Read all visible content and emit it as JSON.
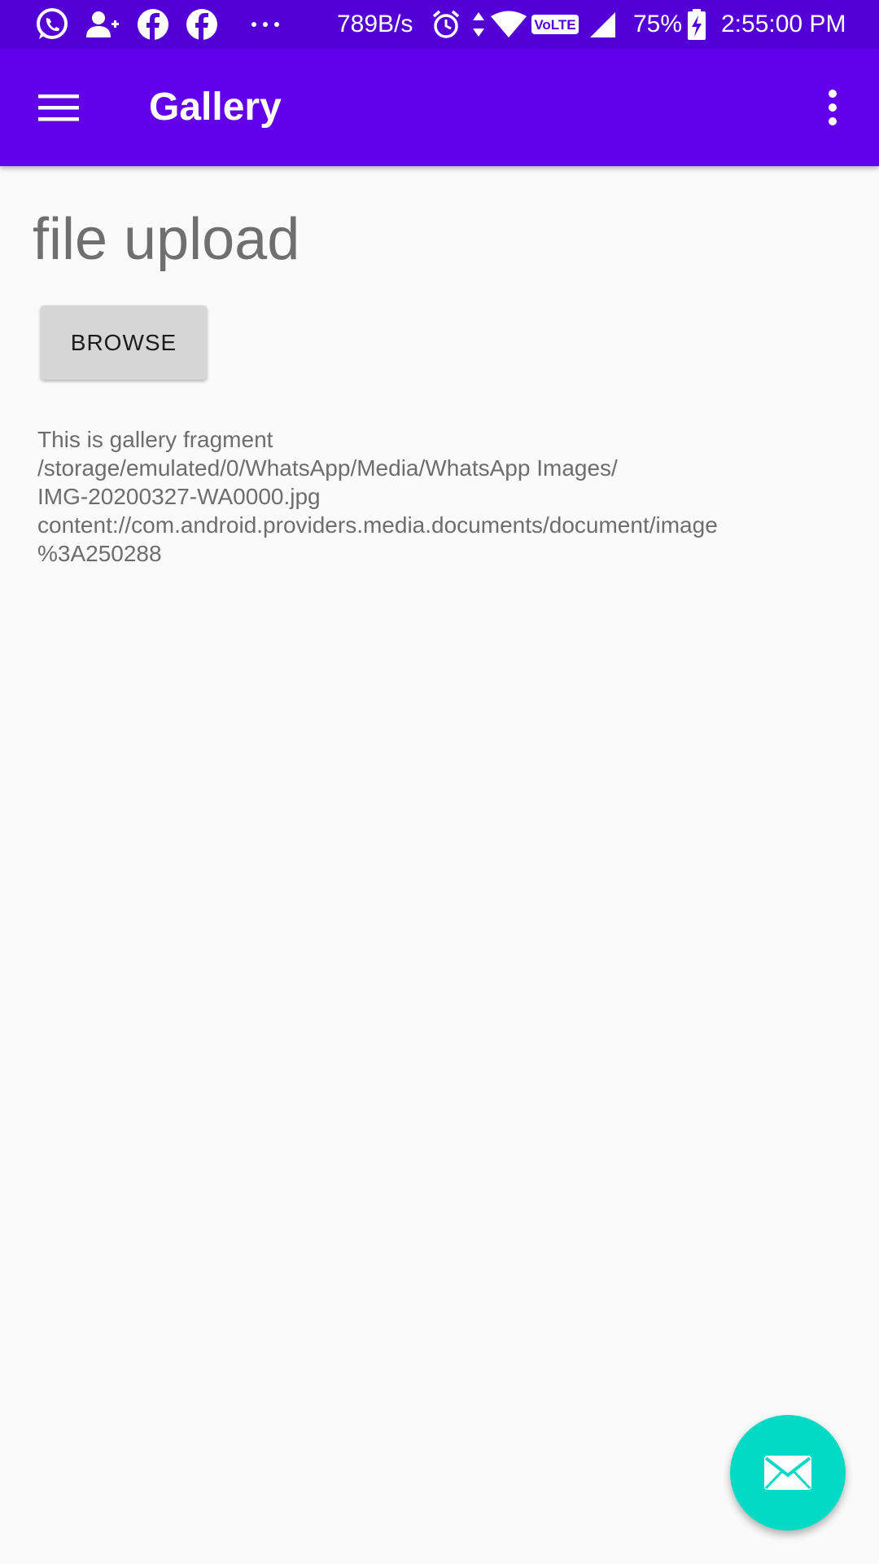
{
  "status_bar": {
    "net_speed": "789B/s",
    "battery": "75%",
    "time": "2:55:00 PM",
    "volte": "VoLTE",
    "notification_icons": [
      "whatsapp-icon",
      "person-add-icon",
      "facebook-icon",
      "facebook-icon",
      "more-dots-icon"
    ],
    "system_icons": [
      "alarm-icon",
      "data-arrows-icon",
      "wifi-icon",
      "volte-icon",
      "signal-icon",
      "battery-charging-icon"
    ]
  },
  "app_bar": {
    "title": "Gallery",
    "background": "#6200ea",
    "status_background": "#5200d6",
    "left_icon": "hamburger-menu-icon",
    "right_icon": "overflow-menu-icon"
  },
  "content": {
    "heading": "file upload",
    "browse_label": "BROWSE",
    "info_lines": [
      "This is gallery fragment",
      "/storage/emulated/0/WhatsApp/Media/WhatsApp Images/",
      "IMG-20200327-WA0000.jpg",
      "content://com.android.providers.media.documents/document/image",
      "%3A250288"
    ]
  },
  "fab": {
    "icon": "email-icon",
    "color": "#03dac5"
  }
}
